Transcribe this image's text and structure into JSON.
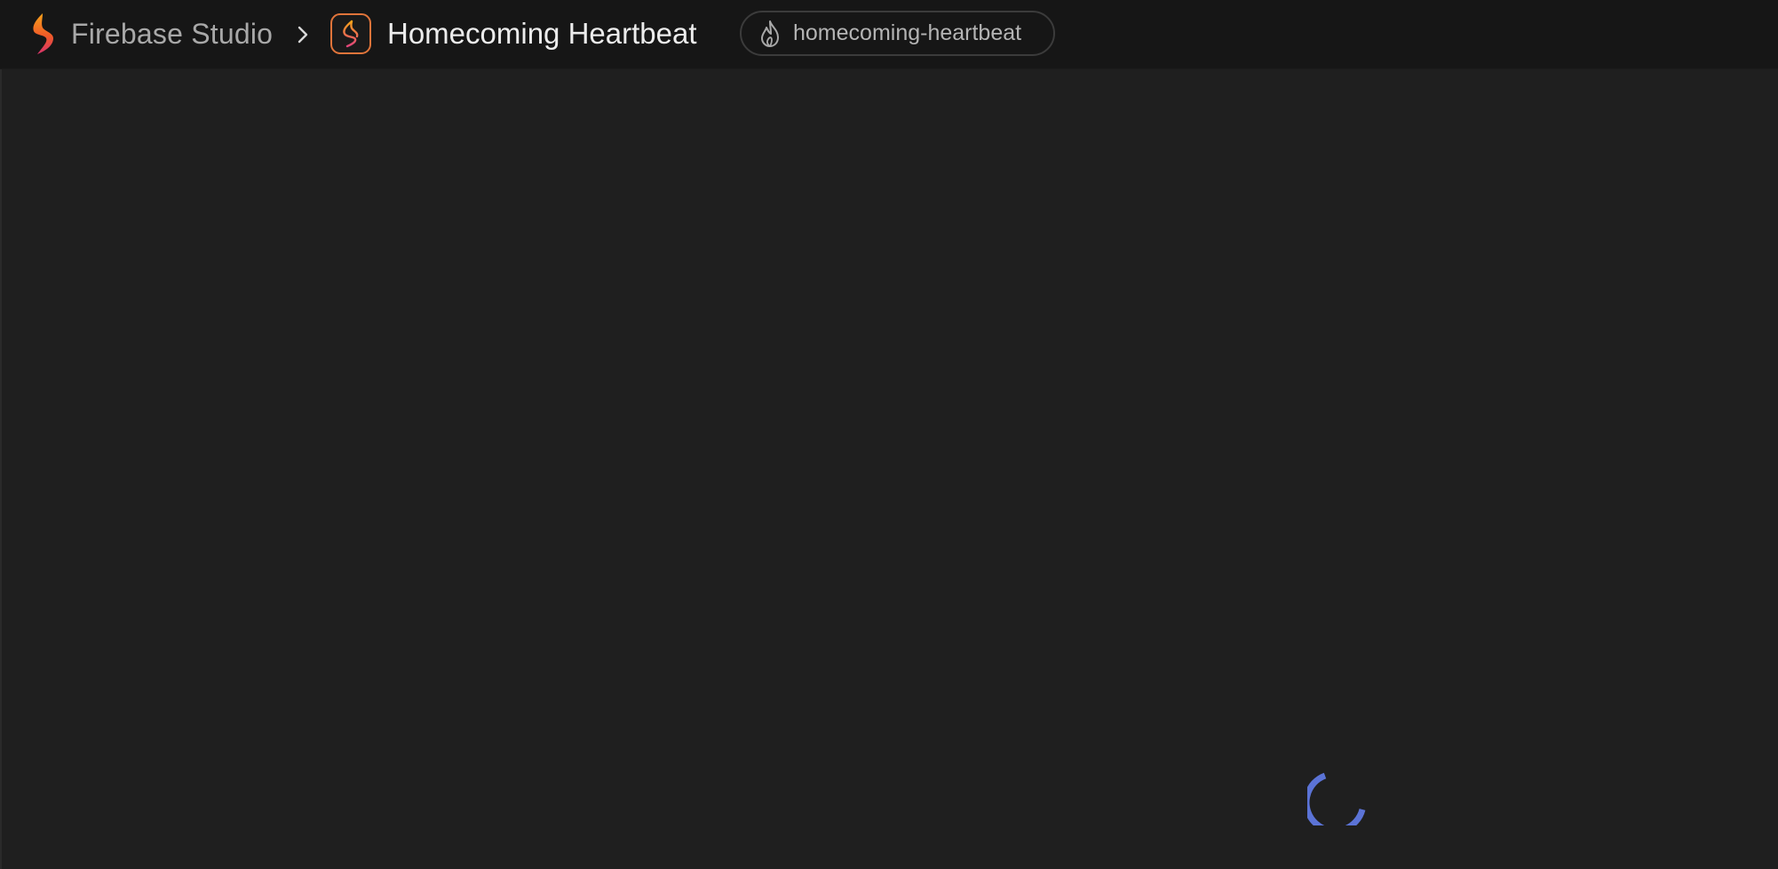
{
  "header": {
    "brand_name": "Firebase Studio",
    "brand_icon": "firebase-studio-logo",
    "separator_icon": "chevron-right-icon",
    "project_icon": "firebase-studio-project-icon",
    "project_name": "Homecoming Heartbeat",
    "project_chip": {
      "icon": "firebase-flame-icon",
      "label": "homecoming-heartbeat"
    }
  },
  "main": {
    "status": "loading",
    "spinner_icon": "loading-spinner-icon"
  },
  "colors": {
    "header_bg": "#161616",
    "main_bg": "#1f1f1f",
    "brand_text": "#a8a8a8",
    "project_text": "#ececec",
    "chip_border": "#3b3b3b",
    "spinner": "#5b73d6",
    "accent_orange": "#f4782a",
    "accent_pink": "#d6336c"
  }
}
